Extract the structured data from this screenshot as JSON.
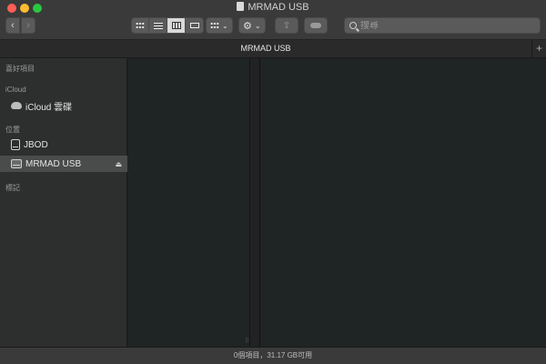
{
  "window": {
    "title": "MRMAD USB"
  },
  "toolbar": {
    "back_icon": "chevron-left-icon",
    "forward_icon": "chevron-right-icon",
    "view_modes": [
      "icon-view",
      "list-view",
      "column-view",
      "gallery-view"
    ],
    "active_view": "column-view",
    "search_placeholder": "搜尋"
  },
  "tabbar": {
    "label": "MRMAD USB",
    "add_label": "+"
  },
  "sidebar": {
    "favorites_header": "喜好項目",
    "icloud_header": "iCloud",
    "icloud_items": [
      {
        "label": "iCloud 雲碟",
        "icon": "cloud-icon"
      }
    ],
    "locations_header": "位置",
    "location_items": [
      {
        "label": "JBOD",
        "icon": "hard-drive-icon"
      },
      {
        "label": "MRMAD USB",
        "icon": "external-drive-icon",
        "selected": true,
        "eject": "⏏"
      }
    ],
    "tags_header": "標記"
  },
  "statusbar": {
    "text": "0個項目，31.17 GB可用"
  }
}
